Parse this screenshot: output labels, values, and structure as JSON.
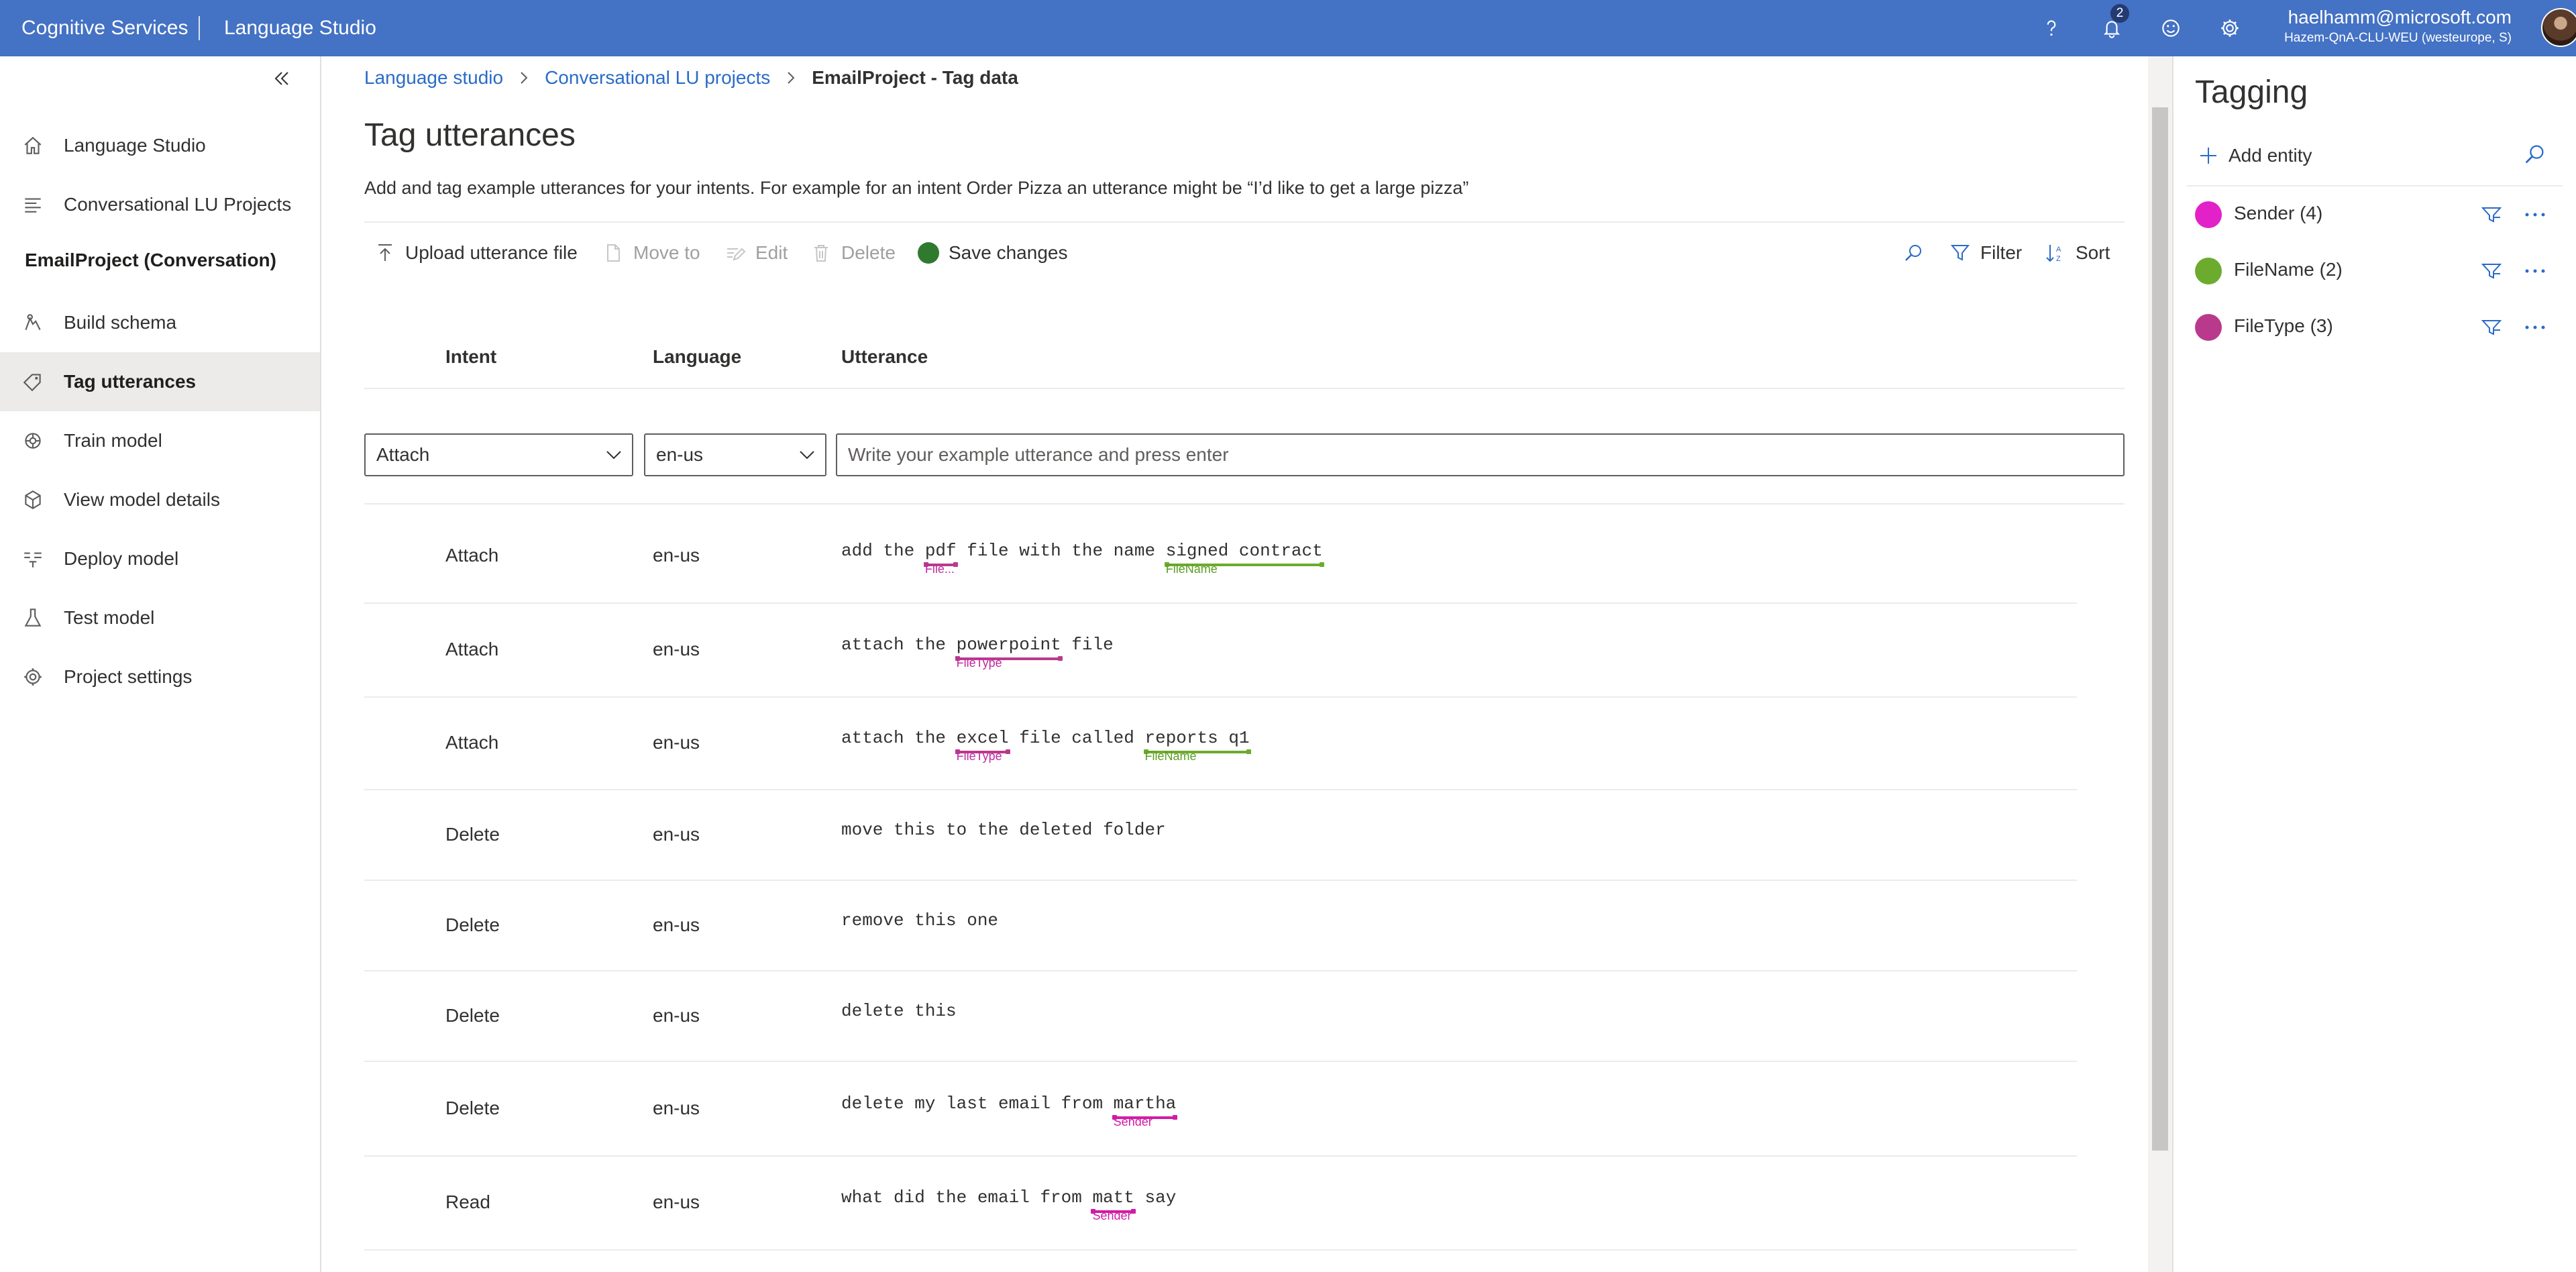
{
  "topbar": {
    "service": "Cognitive Services",
    "app": "Language Studio",
    "notification_count": "2",
    "user_email": "haelhamm@microsoft.com",
    "user_tenant": "Hazem-QnA-CLU-WEU (westeurope, S)"
  },
  "nav": {
    "items": [
      {
        "label": "Language Studio",
        "icon": "home-icon"
      },
      {
        "label": "Conversational LU Projects",
        "icon": "list-icon"
      }
    ],
    "group_label": "EmailProject (Conversation)",
    "project_items": [
      {
        "label": "Build schema",
        "icon": "schema-icon"
      },
      {
        "label": "Tag utterances",
        "icon": "tag-icon",
        "selected": true
      },
      {
        "label": "Train model",
        "icon": "train-icon"
      },
      {
        "label": "View model details",
        "icon": "cube-icon"
      },
      {
        "label": "Deploy model",
        "icon": "deploy-icon"
      },
      {
        "label": "Test model",
        "icon": "flask-icon"
      },
      {
        "label": "Project settings",
        "icon": "gear-icon"
      }
    ]
  },
  "breadcrumb": {
    "items": [
      "Language studio",
      "Conversational LU projects"
    ],
    "current": "EmailProject - Tag data"
  },
  "page": {
    "title": "Tag utterances",
    "description": "Add and tag example utterances for your intents. For example for an intent Order Pizza an utterance might be “I’d like to get a large pizza”"
  },
  "toolbar": {
    "upload": "Upload utterance file",
    "move_to": "Move to",
    "edit": "Edit",
    "delete": "Delete",
    "save": "Save changes",
    "filter": "Filter",
    "sort": "Sort"
  },
  "table": {
    "headers": {
      "intent": "Intent",
      "language": "Language",
      "utterance": "Utterance"
    },
    "new_row": {
      "intent": "Attach",
      "language": "en-us",
      "placeholder": "Write your example utterance and press enter"
    },
    "rows": [
      {
        "intent": "Attach",
        "language": "en-us",
        "segments": [
          {
            "text": "add the "
          },
          {
            "text": "pdf",
            "entity": "FileType",
            "tag": "File..."
          },
          {
            "text": " file with the name "
          },
          {
            "text": "signed contract",
            "entity": "FileName",
            "tag": "FileName"
          }
        ]
      },
      {
        "intent": "Attach",
        "language": "en-us",
        "segments": [
          {
            "text": "attach the "
          },
          {
            "text": "powerpoint",
            "entity": "FileType",
            "tag": "FileType"
          },
          {
            "text": " file"
          }
        ]
      },
      {
        "intent": "Attach",
        "language": "en-us",
        "segments": [
          {
            "text": "attach the "
          },
          {
            "text": "excel",
            "entity": "FileType",
            "tag": "FileType"
          },
          {
            "text": " file called "
          },
          {
            "text": "reports q1",
            "entity": "FileName",
            "tag": "FileName"
          }
        ]
      },
      {
        "intent": "Delete",
        "language": "en-us",
        "segments": [
          {
            "text": "move this to the deleted folder"
          }
        ]
      },
      {
        "intent": "Delete",
        "language": "en-us",
        "segments": [
          {
            "text": "remove this one"
          }
        ]
      },
      {
        "intent": "Delete",
        "language": "en-us",
        "segments": [
          {
            "text": "delete this"
          }
        ]
      },
      {
        "intent": "Delete",
        "language": "en-us",
        "segments": [
          {
            "text": "delete my last email from "
          },
          {
            "text": "martha",
            "entity": "Sender",
            "tag": "Sender"
          }
        ]
      },
      {
        "intent": "Read",
        "language": "en-us",
        "segments": [
          {
            "text": "what did the email from "
          },
          {
            "text": "matt",
            "entity": "Sender",
            "tag": "Sender"
          },
          {
            "text": " say"
          }
        ]
      }
    ]
  },
  "tagging": {
    "title": "Tagging",
    "add_entity": "Add entity",
    "entities": [
      {
        "name": "Sender (4)",
        "key": "Sender",
        "color": "#e222c8"
      },
      {
        "name": "FileName (2)",
        "key": "FileName",
        "color": "#6cab2e"
      },
      {
        "name": "FileType (3)",
        "key": "FileType",
        "color": "#b93a8c"
      }
    ]
  },
  "entity_colors": {
    "Sender": {
      "line": "#d11ba6",
      "tag": "#d11ba6"
    },
    "FileType": {
      "line": "#b93a8c",
      "tag": "#c12aa0"
    },
    "FileName": {
      "line": "#6cab2e",
      "tag": "#5c9e22"
    }
  }
}
